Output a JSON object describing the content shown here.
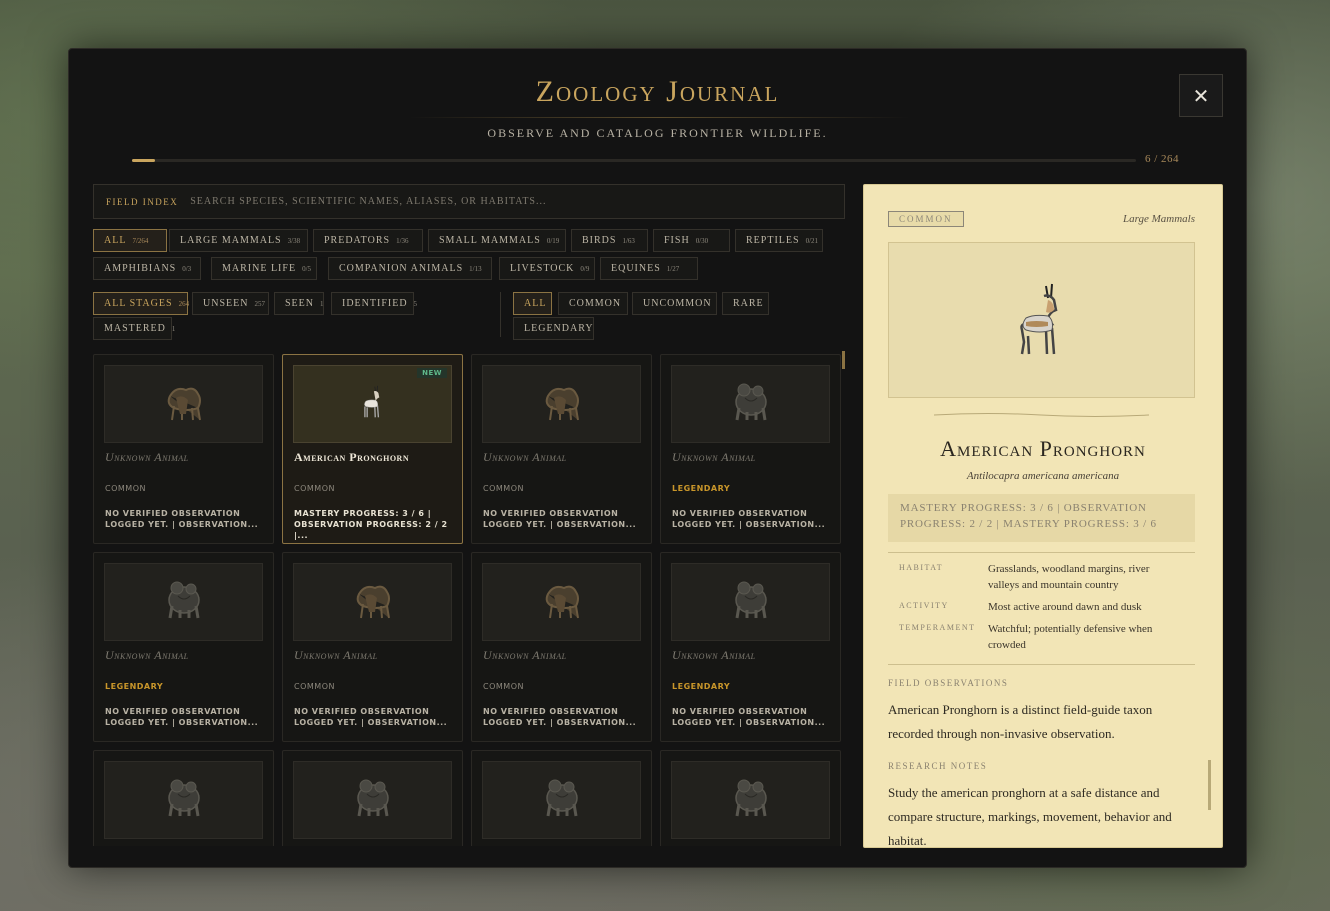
{
  "header": {
    "title": "Zoology Journal",
    "subtitle": "OBSERVE AND CATALOG FRONTIER WILDLIFE.",
    "close_label": "✕",
    "progress_label": "6 / 264",
    "progress_fraction": 0.023
  },
  "search": {
    "label": "Field Index",
    "placeholder": "SEARCH SPECIES, SCIENTIFIC NAMES, ALIASES, OR HABITATS..."
  },
  "categories": [
    {
      "label": "All",
      "count": "7/264",
      "active": true
    },
    {
      "label": "Large Mammals",
      "count": "3/38"
    },
    {
      "label": "Predators",
      "count": "1/36"
    },
    {
      "label": "Small Mammals",
      "count": "0/19"
    },
    {
      "label": "Birds",
      "count": "1/63"
    },
    {
      "label": "Fish",
      "count": "0/30"
    },
    {
      "label": "Reptiles",
      "count": "0/21"
    },
    {
      "label": "Amphibians",
      "count": "0/3"
    },
    {
      "label": "Marine Life",
      "count": "0/5"
    },
    {
      "label": "Companion Animals",
      "count": "1/13"
    },
    {
      "label": "Livestock",
      "count": "0/9"
    },
    {
      "label": "Equines",
      "count": "1/27"
    }
  ],
  "stages": [
    {
      "label": "All Stages",
      "count": "264",
      "active": true
    },
    {
      "label": "Unseen",
      "count": "257"
    },
    {
      "label": "Seen",
      "count": "1"
    },
    {
      "label": "Identified",
      "count": "5"
    },
    {
      "label": "Mastered",
      "count": "1"
    }
  ],
  "rarities": [
    {
      "label": "All",
      "active": true
    },
    {
      "label": "Common"
    },
    {
      "label": "Uncommon"
    },
    {
      "label": "Rare"
    },
    {
      "label": "Legendary"
    }
  ],
  "cards": [
    {
      "name": "Unknown Animal",
      "rarity": "COMMON",
      "obs": "NO VERIFIED OBSERVATION LOGGED YET. | OBSERVATION...",
      "icon": "deer-silhouette-icon"
    },
    {
      "name": "American Pronghorn",
      "rarity": "COMMON",
      "obs": "MASTERY PROGRESS: 3 / 6 | OBSERVATION PROGRESS: 2 / 2 |...",
      "selected": true,
      "new": "NEW",
      "icon": "pronghorn-icon"
    },
    {
      "name": "Unknown Animal",
      "rarity": "COMMON",
      "obs": "NO VERIFIED OBSERVATION LOGGED YET. | OBSERVATION...",
      "icon": "deer-silhouette-icon"
    },
    {
      "name": "Unknown Animal",
      "rarity": "LEGENDARY",
      "legendary": true,
      "obs": "NO VERIFIED OBSERVATION LOGGED YET. | OBSERVATION...",
      "icon": "bear-silhouette-icon"
    },
    {
      "name": "Unknown Animal",
      "rarity": "LEGENDARY",
      "legendary": true,
      "obs": "NO VERIFIED OBSERVATION LOGGED YET. | OBSERVATION...",
      "icon": "bear-silhouette-icon"
    },
    {
      "name": "Unknown Animal",
      "rarity": "COMMON",
      "obs": "NO VERIFIED OBSERVATION LOGGED YET. | OBSERVATION...",
      "icon": "deer-silhouette-icon"
    },
    {
      "name": "Unknown Animal",
      "rarity": "COMMON",
      "obs": "NO VERIFIED OBSERVATION LOGGED YET. | OBSERVATION...",
      "icon": "deer-silhouette-icon"
    },
    {
      "name": "Unknown Animal",
      "rarity": "LEGENDARY",
      "legendary": true,
      "obs": "NO VERIFIED OBSERVATION LOGGED YET. | OBSERVATION...",
      "icon": "bear-silhouette-icon"
    },
    {
      "name": "",
      "rarity": "",
      "obs": "",
      "icon": "bear-silhouette-icon"
    },
    {
      "name": "",
      "rarity": "",
      "obs": "",
      "icon": "bear-silhouette-icon"
    },
    {
      "name": "",
      "rarity": "",
      "obs": "",
      "icon": "bear-silhouette-icon"
    },
    {
      "name": "",
      "rarity": "",
      "obs": "",
      "icon": "bear-silhouette-icon"
    }
  ],
  "detail": {
    "rarity": "COMMON",
    "category": "Large Mammals",
    "name": "American Pronghorn",
    "scientific": "Antilocapra americana americana",
    "progress": "Mastery Progress: 3 / 6 | Observation Progress: 2 / 2 | Mastery Progress: 3 / 6",
    "attributes": [
      {
        "key": "Habitat",
        "value": "Grasslands, woodland margins, river valleys and mountain country"
      },
      {
        "key": "Activity",
        "value": "Most active around dawn and dusk"
      },
      {
        "key": "Temperament",
        "value": "Watchful; potentially defensive when crowded"
      }
    ],
    "field_obs_heading": "Field Observations",
    "field_obs_text": "American Pronghorn is a distinct field-guide taxon recorded through non-invasive observation.",
    "research_heading": "Research Notes",
    "research_text": "Study the american pronghorn at a safe distance and compare structure, markings, movement, behavior and habitat."
  },
  "colors": {
    "accent": "#c9a55e",
    "legendary": "#c9962a",
    "new_badge": "#5fb88a",
    "parchment": "#f2e5b6"
  }
}
